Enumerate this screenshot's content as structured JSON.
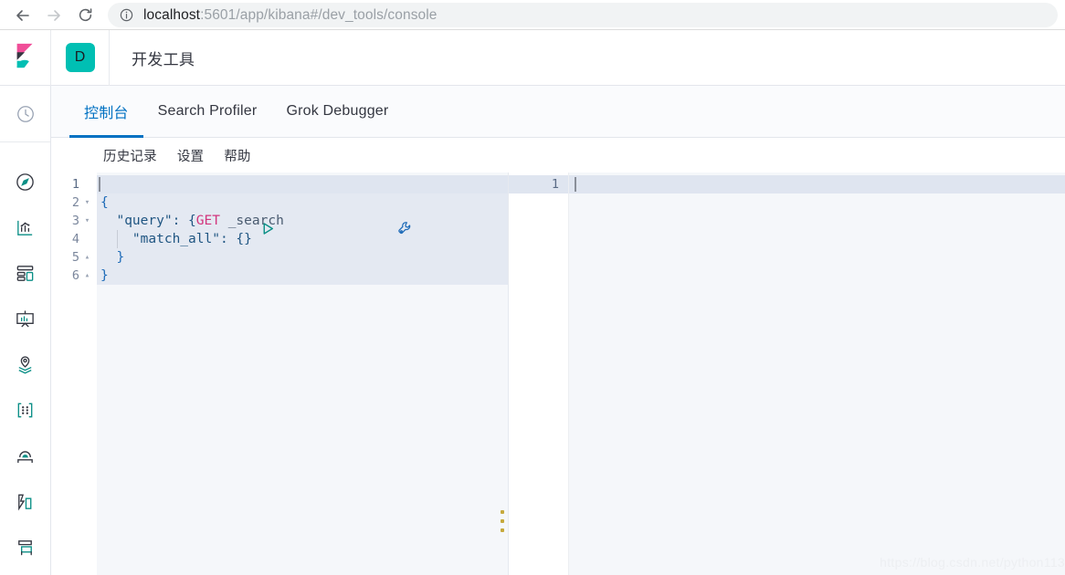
{
  "browser": {
    "back_icon": "back-arrow-icon",
    "forward_icon": "forward-arrow-icon",
    "reload_icon": "reload-icon",
    "info_icon": "site-info-icon",
    "url_host": "localhost",
    "url_path": ":5601/app/kibana#/dev_tools/console",
    "url_full": "localhost:5601/app/kibana#/dev_tools/console"
  },
  "sidebar": {
    "items": [
      {
        "name": "recently-viewed",
        "icon": "clock-icon"
      },
      {
        "name": "discover",
        "icon": "compass-icon"
      },
      {
        "name": "visualize",
        "icon": "bar-chart-icon"
      },
      {
        "name": "dashboard",
        "icon": "dashboard-grid-icon"
      },
      {
        "name": "canvas",
        "icon": "presentation-icon"
      },
      {
        "name": "maps",
        "icon": "map-pin-layers-icon"
      },
      {
        "name": "machine-learning",
        "icon": "machine-learning-icon"
      },
      {
        "name": "infrastructure",
        "icon": "apm-icon"
      },
      {
        "name": "logs",
        "icon": "logs-icon"
      },
      {
        "name": "metrics",
        "icon": "metrics-icon"
      }
    ]
  },
  "header": {
    "logo": "kibana-logo",
    "app_badge": "D",
    "title": "开发工具"
  },
  "tabs": [
    {
      "label": "控制台",
      "active": true
    },
    {
      "label": "Search Profiler",
      "active": false
    },
    {
      "label": "Grok Debugger",
      "active": false
    }
  ],
  "submenu": [
    {
      "label": "历史记录"
    },
    {
      "label": "设置"
    },
    {
      "label": "帮助"
    }
  ],
  "editor": {
    "play_icon": "play-triangle-icon",
    "wrench_icon": "wrench-icon",
    "drag_handle_icon": "drag-handle-icon",
    "line_numbers": [
      "1",
      "2",
      "3",
      "4",
      "5",
      "6"
    ],
    "fold_markers": [
      "",
      "▾",
      "▾",
      "",
      "▴",
      "▴"
    ],
    "lines": [
      {
        "method": "GET",
        "path": " _search"
      },
      {
        "text": "{"
      },
      {
        "text": "  \"query\": {"
      },
      {
        "text": "    \"match_all\": {}"
      },
      {
        "text": "  }"
      },
      {
        "text": "}"
      }
    ],
    "request_text": "GET _search\n{\n  \"query\": {\n    \"match_all\": {}\n  }\n}"
  },
  "response": {
    "line_numbers": [
      "1"
    ],
    "content": ""
  },
  "watermark": "https://blog.csdn.net/python113",
  "colors": {
    "accent_blue": "#0071c2",
    "teal": "#00bfb3",
    "pink": "#f04e98",
    "method_pink": "#d2357d",
    "string_blue": "#1f5582",
    "editor_bg": "#f5f7fa",
    "active_line": "#dfe5f0"
  }
}
